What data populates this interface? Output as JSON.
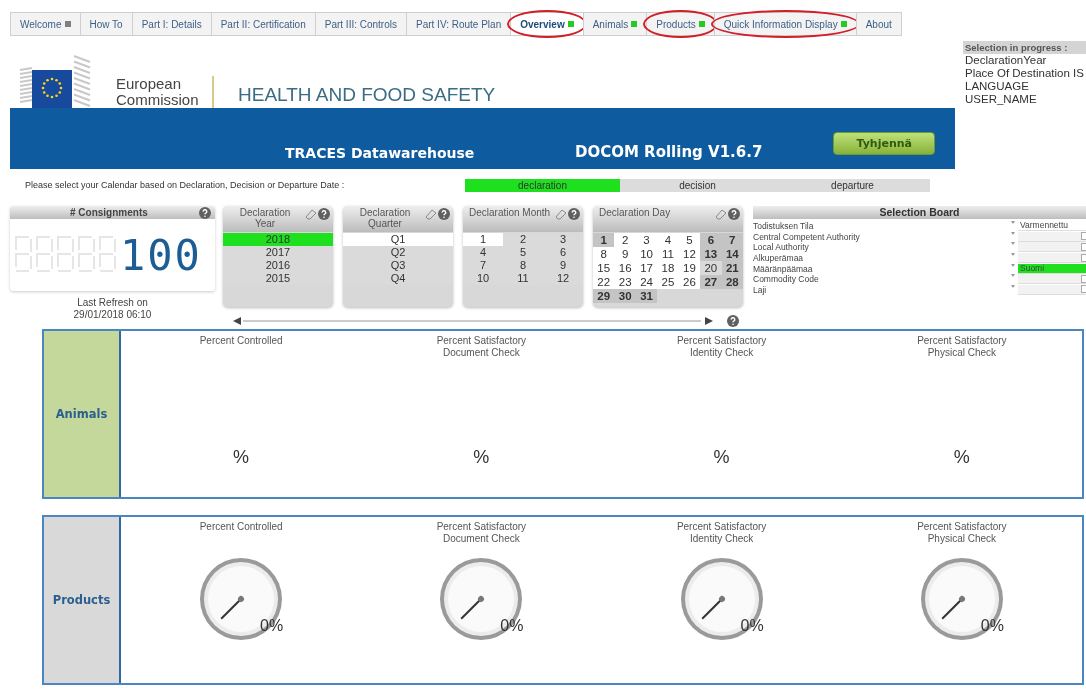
{
  "tabs": [
    {
      "label": "Welcome",
      "selected": false,
      "color": "#7f7f7f",
      "annotated": false
    },
    {
      "label": "How To",
      "selected": false,
      "annotated": false
    },
    {
      "label": "Part I: Details",
      "selected": false,
      "annotated": false
    },
    {
      "label": "Part II: Certification",
      "selected": false,
      "annotated": false
    },
    {
      "label": "Part III: Controls",
      "selected": false,
      "annotated": false
    },
    {
      "label": "Part IV: Route Plan",
      "selected": false,
      "annotated": false
    },
    {
      "label": "Overview",
      "selected": true,
      "color": "#22cc22",
      "annotated": true
    },
    {
      "label": "Animals",
      "selected": false,
      "color": "#22cc22",
      "annotated": false
    },
    {
      "label": "Products",
      "selected": false,
      "color": "#22cc22",
      "annotated": true
    },
    {
      "label": "Quick Information Display",
      "selected": false,
      "color": "#22cc22",
      "annotated": true
    },
    {
      "label": "About",
      "selected": false,
      "annotated": false
    }
  ],
  "header": {
    "org_name": "European Commission",
    "department": "HEALTH AND FOOD SAFETY"
  },
  "banner": {
    "app_name": "TRACES Datawarehouse",
    "version": "DOCOM Rolling V1.6.7",
    "clear_button": "Tyhjennä"
  },
  "selection_in_progress": {
    "title": "Selection in progress :",
    "items": [
      "DeclarationYear",
      "Place Of Destination IS",
      "LANGUAGE",
      "USER_NAME"
    ]
  },
  "calendar_basis": {
    "prompt": "Please select your Calendar based on Declaration, Decision or Departure Date :",
    "options": [
      {
        "label": "declaration",
        "selected": true
      },
      {
        "label": "decision",
        "selected": false
      },
      {
        "label": "departure",
        "selected": false
      }
    ]
  },
  "consignments": {
    "title": "# Consignments",
    "value": "100",
    "last_refresh_label": "Last Refresh on",
    "last_refresh_time": "29/01/2018 06:10"
  },
  "filters": [
    {
      "title": "Declaration Year",
      "kind": "list",
      "items": [
        {
          "label": "2018",
          "selected": true,
          "available": false,
          "excluded": false
        },
        {
          "label": "2017",
          "selected": false,
          "available": false,
          "excluded": false
        },
        {
          "label": "2016",
          "selected": false,
          "available": false,
          "excluded": false
        },
        {
          "label": "2015",
          "selected": false,
          "available": false,
          "excluded": false
        }
      ]
    },
    {
      "title": "Declaration Quarter",
      "kind": "list",
      "items": [
        {
          "label": "Q1",
          "selected": false,
          "available": true,
          "excluded": false
        },
        {
          "label": "Q2",
          "selected": false,
          "available": false,
          "excluded": false
        },
        {
          "label": "Q3",
          "selected": false,
          "available": false,
          "excluded": false
        },
        {
          "label": "Q4",
          "selected": false,
          "available": false,
          "excluded": false
        }
      ]
    },
    {
      "title": "Declaration Month",
      "kind": "months",
      "items": [
        {
          "label": "1",
          "selected": false,
          "available": true,
          "excluded": false
        },
        {
          "label": "2",
          "selected": false,
          "available": false,
          "excluded": false
        },
        {
          "label": "3",
          "selected": false,
          "available": false,
          "excluded": false
        },
        {
          "label": "4",
          "selected": false,
          "available": false,
          "excluded": false
        },
        {
          "label": "5",
          "selected": false,
          "available": false,
          "excluded": false
        },
        {
          "label": "6",
          "selected": false,
          "available": false,
          "excluded": false
        },
        {
          "label": "7",
          "selected": false,
          "available": false,
          "excluded": false
        },
        {
          "label": "8",
          "selected": false,
          "available": false,
          "excluded": false
        },
        {
          "label": "9",
          "selected": false,
          "available": false,
          "excluded": false
        },
        {
          "label": "10",
          "selected": false,
          "available": false,
          "excluded": false
        },
        {
          "label": "11",
          "selected": false,
          "available": false,
          "excluded": false
        },
        {
          "label": "12",
          "selected": false,
          "available": false,
          "excluded": false
        }
      ]
    },
    {
      "title": "Declaration Day",
      "kind": "days",
      "items": [
        {
          "label": "1",
          "selected": false,
          "available": false,
          "excluded": true
        },
        {
          "label": "2",
          "selected": false,
          "available": true,
          "excluded": false
        },
        {
          "label": "3",
          "selected": false,
          "available": true,
          "excluded": false
        },
        {
          "label": "4",
          "selected": false,
          "available": true,
          "excluded": false
        },
        {
          "label": "5",
          "selected": false,
          "available": true,
          "excluded": false
        },
        {
          "label": "6",
          "selected": false,
          "available": false,
          "excluded": true
        },
        {
          "label": "7",
          "selected": false,
          "available": false,
          "excluded": true
        },
        {
          "label": "8",
          "selected": false,
          "available": true,
          "excluded": false
        },
        {
          "label": "9",
          "selected": false,
          "available": true,
          "excluded": false
        },
        {
          "label": "10",
          "selected": false,
          "available": true,
          "excluded": false
        },
        {
          "label": "11",
          "selected": false,
          "available": true,
          "excluded": false
        },
        {
          "label": "12",
          "selected": false,
          "available": true,
          "excluded": false
        },
        {
          "label": "13",
          "selected": false,
          "available": false,
          "excluded": true
        },
        {
          "label": "14",
          "selected": false,
          "available": false,
          "excluded": true
        },
        {
          "label": "15",
          "selected": false,
          "available": true,
          "excluded": false
        },
        {
          "label": "16",
          "selected": false,
          "available": true,
          "excluded": false
        },
        {
          "label": "17",
          "selected": false,
          "available": true,
          "excluded": false
        },
        {
          "label": "18",
          "selected": false,
          "available": true,
          "excluded": false
        },
        {
          "label": "19",
          "selected": false,
          "available": true,
          "excluded": false
        },
        {
          "label": "20",
          "selected": false,
          "available": false,
          "excluded": false
        },
        {
          "label": "21",
          "selected": false,
          "available": false,
          "excluded": true
        },
        {
          "label": "22",
          "selected": false,
          "available": true,
          "excluded": false
        },
        {
          "label": "23",
          "selected": false,
          "available": true,
          "excluded": false
        },
        {
          "label": "24",
          "selected": false,
          "available": true,
          "excluded": false
        },
        {
          "label": "25",
          "selected": false,
          "available": true,
          "excluded": false
        },
        {
          "label": "26",
          "selected": false,
          "available": true,
          "excluded": false
        },
        {
          "label": "27",
          "selected": false,
          "available": false,
          "excluded": true
        },
        {
          "label": "28",
          "selected": false,
          "available": false,
          "excluded": true
        },
        {
          "label": "29",
          "selected": false,
          "available": false,
          "excluded": true
        },
        {
          "label": "30",
          "selected": false,
          "available": false,
          "excluded": true
        },
        {
          "label": "31",
          "selected": false,
          "available": false,
          "excluded": true
        }
      ]
    }
  ],
  "selection_board": {
    "title": "Selection Board",
    "rows": [
      {
        "field": "Todistuksen Tila",
        "value": "Varmennettu",
        "selected": false
      },
      {
        "field": "Central Competent Authority",
        "selected": false
      },
      {
        "field": "Local Authority",
        "selected": false
      },
      {
        "field": "Alkuperämaa",
        "selected": false
      },
      {
        "field": "Määränpäämaa",
        "value": "Suomi",
        "selected": true
      },
      {
        "field": "Commodity Code",
        "selected": false
      },
      {
        "field": "Laji",
        "selected": false
      }
    ]
  },
  "panels": [
    {
      "label": "Animals",
      "kind": "percent",
      "color": "#c4d89c",
      "metrics": [
        {
          "title": "Percent Controlled",
          "reading": "%"
        },
        {
          "title": "Percent Satisfactory Document Check",
          "reading": "%"
        },
        {
          "title": "Percent Satisfactory Identity Check",
          "reading": "%"
        },
        {
          "title": "Percent Satisfactory Physical Check",
          "reading": "%"
        }
      ]
    },
    {
      "label": "Products",
      "kind": "gauge",
      "color": "#d9d9d9",
      "metrics": [
        {
          "title": "Percent Controlled",
          "reading": "0%"
        },
        {
          "title": "Percent Satisfactory Document Check",
          "reading": "0%"
        },
        {
          "title": "Percent Satisfactory Identity Check",
          "reading": "0%"
        },
        {
          "title": "Percent Satisfactory Physical Check",
          "reading": "0%"
        }
      ]
    }
  ]
}
